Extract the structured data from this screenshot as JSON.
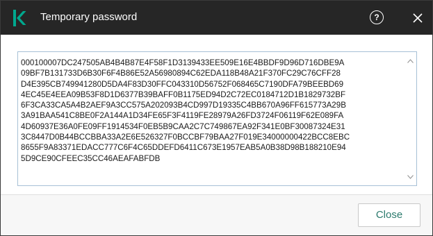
{
  "window": {
    "title": "Temporary password",
    "help_glyph": "?",
    "logo_icon": "kaspersky-k-logo",
    "colors": {
      "titlebar_bg": "#262626",
      "logo_green": "#00a88e",
      "close_button_text": "#2b7a6d",
      "textbox_border": "#a6c0d6"
    }
  },
  "password": {
    "lines": [
      "000100007DC247505AB4B4B87E4F58F1D3139433EE509E16E4BBDF9D96D716DBE9A",
      "09BF7B131733D6B30F6F4B86E52A56980894C62EDA118B48A21F370FC29C76CFF28",
      "D4E395CB749941280D5DA4F83D30FFC043310D56752F068465C7190DFA79BEEBD69",
      "4EC45E4EEA09B53F8D1D6377B39BAFF0B1175ED94D2C72EC0184712D1B1829732BF",
      "6F3CA33CA5A4B2AEF9A3CC575A202093B4CD997D19335C4BB670A96FF615773A29B",
      "3A91BAA541C8BE0F2A144A1D34FE65F3F4119FE28979A26FD3724F06119F62E089FA",
      "4D60937E36A0FE09FF1914534F0EB5B9CAA2C7C749867EA92F341E0BF30087324E31",
      "3C8447D0B44BCCBBA33A2E6E526327F0BCCBF79BAA27F019E34000000422BCC8EBC",
      "8655F9A83371EDACC777C6F4C65DDEFD6411C673E1957EAB5A0B38D98B188210E94",
      "5D9CE90CFEEC35CC46AEAFABFDB"
    ]
  },
  "footer": {
    "close_label": "Close"
  }
}
